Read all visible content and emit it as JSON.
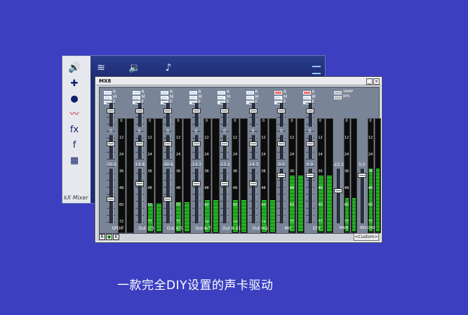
{
  "back_window": {
    "label": "kX Mixer",
    "top_icons": [
      "speaker-icon",
      "sound-wave-icon",
      "speaker-wave-icon",
      "speaker-note-icon"
    ],
    "side_icons": [
      "speaker-icon",
      "network-icon",
      "record-icon",
      "graph-icon",
      "fx-icon",
      "function-icon",
      "keyboard-icon"
    ]
  },
  "mx8": {
    "title": "MX8",
    "rme_letters": [
      "R",
      "M",
      "E"
    ],
    "swap_letters": [
      "SWAP",
      "BPS"
    ],
    "scale_labels": [
      "0",
      "12",
      "24",
      "36",
      "48",
      "60",
      "72"
    ],
    "channels": [
      {
        "label": "SPDIF",
        "values": [
          "0",
          "0",
          "-30.0"
        ],
        "levels": [
          0.0,
          0.0
        ]
      },
      {
        "label": "Out 2/3",
        "values": [
          "0",
          "0",
          "-14.8"
        ],
        "levels": [
          0.25,
          0.25
        ]
      },
      {
        "label": "Out 4/5",
        "values": [
          "0",
          "0",
          "-30.6"
        ],
        "levels": [
          0.26,
          0.26
        ]
      },
      {
        "label": "Out 6/7",
        "values": [
          "0",
          "0",
          "-13.2"
        ],
        "levels": [
          0.28,
          0.28
        ]
      },
      {
        "label": "Out 8-31",
        "values": [
          "0",
          "0",
          "-13.2"
        ],
        "levels": [
          0.28,
          0.28
        ]
      },
      {
        "label": "Out HQ",
        "values": [
          "0",
          "0",
          "-14.3"
        ],
        "levels": [
          0.28,
          0.28
        ]
      },
      {
        "label": "MIC",
        "values": [
          "0",
          "0",
          "0.0"
        ],
        "levels": [
          0.5,
          0.5
        ]
      },
      {
        "label": "EFX",
        "values": [
          "0",
          "0",
          "0.0"
        ],
        "levels": [
          0.5,
          0.5
        ]
      }
    ],
    "main": {
      "label": "MAIN",
      "value": "-23.3",
      "levels": [
        0.3,
        0.3
      ]
    },
    "record": {
      "label": "RECORD",
      "value": "0.0",
      "levels": [
        0.56,
        0.56
      ]
    },
    "bottom_buttons": [
      "R",
      "●",
      "K"
    ],
    "preset": "<Custom>"
  },
  "caption": "一款完全DIY设置的声卡驱动"
}
